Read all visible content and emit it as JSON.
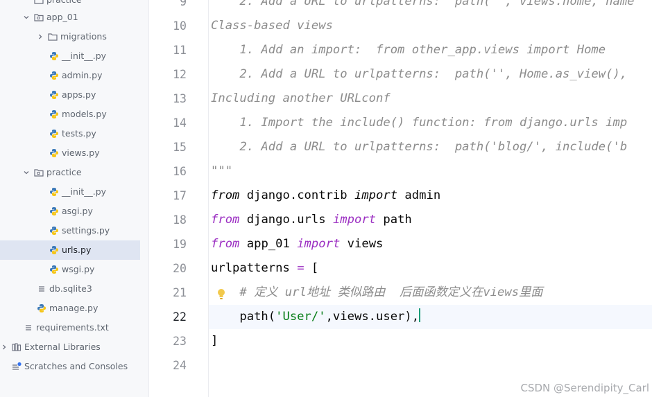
{
  "project_tree": {
    "top_partial": "practice",
    "items": [
      {
        "label": "app_01",
        "icon": "folder-icon",
        "expanded": true
      },
      {
        "label": "migrations",
        "icon": "folder-icon",
        "expanded": false
      },
      {
        "label": "__init__.py",
        "icon": "python-file-icon"
      },
      {
        "label": "admin.py",
        "icon": "python-file-icon"
      },
      {
        "label": "apps.py",
        "icon": "python-file-icon"
      },
      {
        "label": "models.py",
        "icon": "python-file-icon"
      },
      {
        "label": "tests.py",
        "icon": "python-file-icon"
      },
      {
        "label": "views.py",
        "icon": "python-file-icon"
      },
      {
        "label": "practice",
        "icon": "folder-icon",
        "expanded": true
      },
      {
        "label": "__init__.py",
        "icon": "python-file-icon"
      },
      {
        "label": "asgi.py",
        "icon": "python-file-icon"
      },
      {
        "label": "settings.py",
        "icon": "python-file-icon"
      },
      {
        "label": "urls.py",
        "icon": "python-file-icon",
        "selected": true
      },
      {
        "label": "wsgi.py",
        "icon": "python-file-icon"
      },
      {
        "label": "db.sqlite3",
        "icon": "text-file-icon"
      },
      {
        "label": "manage.py",
        "icon": "python-file-icon"
      },
      {
        "label": "requirements.txt",
        "icon": "text-file-icon"
      },
      {
        "label": "External Libraries",
        "icon": "library-icon"
      },
      {
        "label": "Scratches and Consoles",
        "icon": "scratches-icon"
      }
    ]
  },
  "editor": {
    "current_line": "22",
    "line_numbers": [
      "9",
      "10",
      "11",
      "12",
      "13",
      "14",
      "15",
      "16",
      "17",
      "18",
      "19",
      "20",
      "21",
      "22",
      "23",
      "24"
    ],
    "lines": {
      "l9": "    2. Add a URL to urlpatterns:  path('', views.home, name",
      "l10": "Class-based views",
      "l11": "    1. Add an import:  from other_app.views import Home",
      "l12": "    2. Add a URL to urlpatterns:  path('', Home.as_view(),",
      "l13": "Including another URLconf",
      "l14": "    1. Import the include() function: from django.urls imp",
      "l15": "    2. Add a URL to urlpatterns:  path('blog/', include('b",
      "l16": "\"\"\"",
      "l17": {
        "kw1": "from",
        "mod": " django.contrib ",
        "kw2": "import",
        "name": " admin"
      },
      "l18": {
        "kw1": "from",
        "mod": " django.urls ",
        "kw2": "import",
        "name": " path"
      },
      "l19": {
        "kw1": "from",
        "mod": " app_01 ",
        "kw2": "import",
        "name": " views"
      },
      "l20": {
        "name": "urlpatterns ",
        "op": "=",
        "rest": " ["
      },
      "l21": "    # 定义 url地址 类似路由  后面函数定义在views里面",
      "l22": {
        "fn": "    path(",
        "str": "'User/'",
        "rest": ",views.user),"
      },
      "l23": "]"
    }
  },
  "watermark": "CSDN @Serendipity_Carl",
  "colors": {
    "keyword": "#9b2ec2",
    "string": "#067d17",
    "comment": "#8c8c8c",
    "caret": "#1a9c7a",
    "selection": "#dfe5f2"
  }
}
